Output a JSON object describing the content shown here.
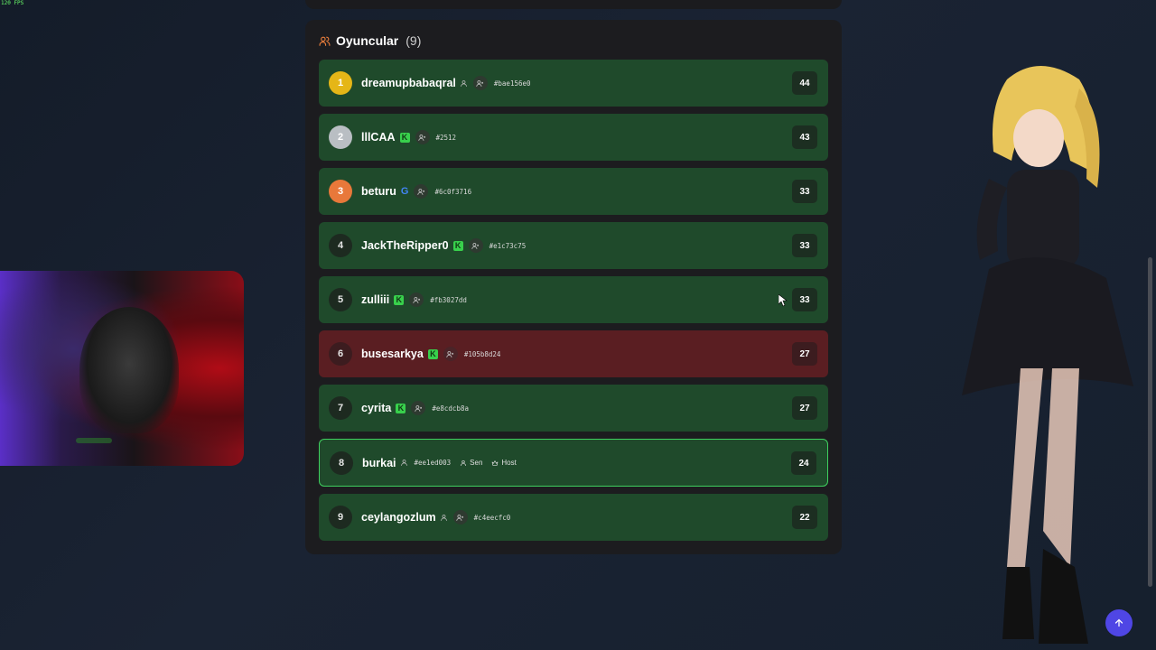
{
  "fps": "120 FPS",
  "panel": {
    "title": "Oyuncular",
    "count": "(9)"
  },
  "players": [
    {
      "rank": "1",
      "name": "dreamupbabaqral",
      "id": "#bae156e0",
      "score": "44"
    },
    {
      "rank": "2",
      "name": "lllCAA",
      "id": "#2512",
      "score": "43"
    },
    {
      "rank": "3",
      "name": "beturu",
      "id": "#6c0f3716",
      "score": "33"
    },
    {
      "rank": "4",
      "name": "JackTheRipper0",
      "id": "#e1c73c75",
      "score": "33"
    },
    {
      "rank": "5",
      "name": "zulliii",
      "id": "#fb3027dd",
      "score": "33"
    },
    {
      "rank": "6",
      "name": "busesarkya",
      "id": "#105b8d24",
      "score": "27"
    },
    {
      "rank": "7",
      "name": "cyrita",
      "id": "#e8cdcb8a",
      "score": "27"
    },
    {
      "rank": "8",
      "name": "burkai",
      "id": "#ee1ed003",
      "score": "24",
      "you_label": "Sen",
      "host_label": "Host"
    },
    {
      "rank": "9",
      "name": "ceylangozlum",
      "id": "#c4eecfc0",
      "score": "22"
    }
  ],
  "badges": {
    "kick": "K",
    "google": "G"
  },
  "colors": {
    "row_green": "#1f4a2b",
    "row_red": "#5a1e22",
    "gold": "#e5b617",
    "silver": "#b9bec3",
    "bronze": "#e8783a",
    "fab": "#4f46e5"
  },
  "icons": {
    "players": "users-icon",
    "user": "user-icon",
    "hidden": "user-x-icon",
    "host": "crown-icon",
    "scroll_top": "arrow-up-icon"
  }
}
